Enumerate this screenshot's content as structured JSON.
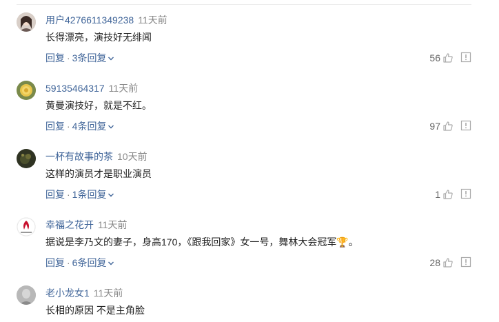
{
  "comments": [
    {
      "username": "用户4276611349238",
      "time": "11天前",
      "text": "长得漂亮，演技好无绯闻",
      "reply_label": "回复",
      "separator": "·",
      "replies_label": "3条回复",
      "likes": "56",
      "avatar": "photo-woman"
    },
    {
      "username": "59135464317",
      "time": "11天前",
      "text": "黄曼演技好，就是不红。",
      "reply_label": "回复",
      "separator": "·",
      "replies_label": "4条回复",
      "likes": "97",
      "avatar": "yellow-rose"
    },
    {
      "username": "一杯有故事的茶",
      "time": "10天前",
      "text": "这样的演员才是职业演员",
      "reply_label": "回复",
      "separator": "·",
      "replies_label": "1条回复",
      "likes": "1",
      "avatar": "dark-plant"
    },
    {
      "username": "幸福之花开",
      "time": "11天前",
      "text": "据说是李乃文的妻子，身高170，《跟我回家》女一号，舞林大会冠军🏆。",
      "reply_label": "回复",
      "separator": "·",
      "replies_label": "6条回复",
      "likes": "28",
      "avatar": "yoga-logo"
    },
    {
      "username": "老小龙女1",
      "time": "11天前",
      "text": "长相的原因 不是主角脸",
      "avatar": "photo-grey"
    }
  ],
  "colors": {
    "username": "#406599",
    "link": "#406599",
    "meta": "#888888",
    "text": "#222222",
    "icon": "#aaaaaa"
  },
  "icons": {
    "like": "thumbs-up-icon",
    "report": "report-icon",
    "expand": "chevron-down-icon"
  }
}
